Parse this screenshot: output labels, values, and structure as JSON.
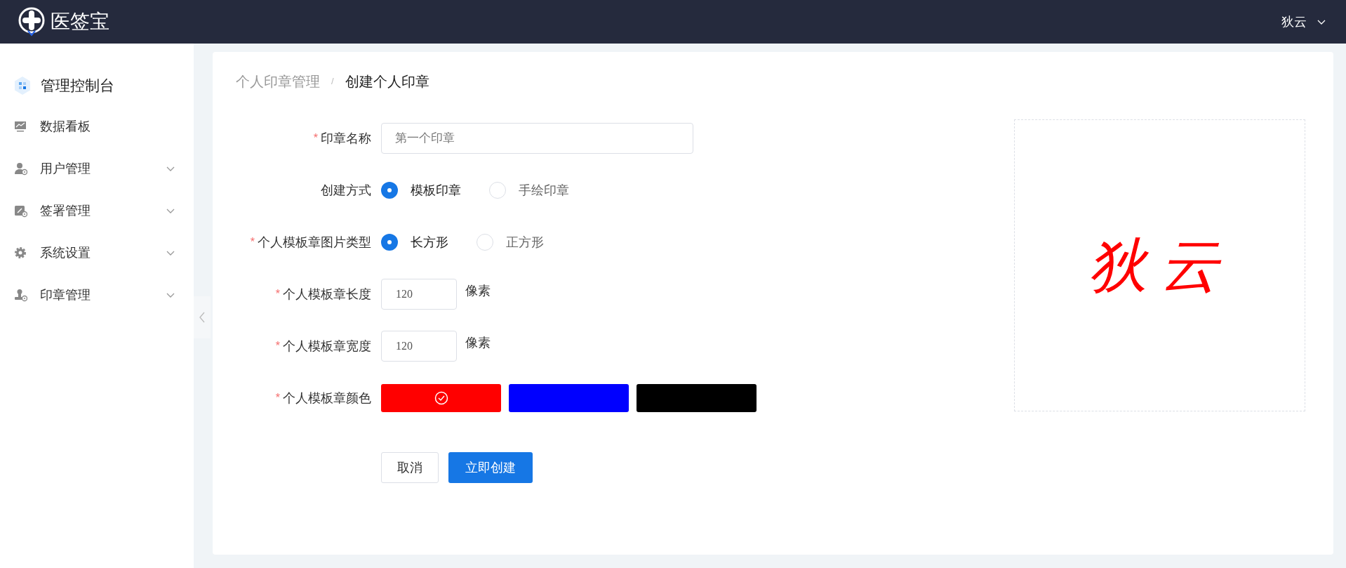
{
  "header": {
    "logo_text": "医签宝",
    "user": "狄云"
  },
  "sidebar": {
    "title": "管理控制台",
    "items": [
      {
        "label": "数据看板",
        "expandable": false
      },
      {
        "label": "用户管理",
        "expandable": true
      },
      {
        "label": "签署管理",
        "expandable": true
      },
      {
        "label": "系统设置",
        "expandable": true
      },
      {
        "label": "印章管理",
        "expandable": true
      }
    ]
  },
  "breadcrumb": {
    "separator": "/",
    "items": [
      {
        "label": "个人印章管理",
        "current": false
      },
      {
        "label": "创建个人印章",
        "current": true
      }
    ]
  },
  "form": [
    {
      "kind": "text",
      "label": "印章名称",
      "required_mark": "*",
      "placeholder": "第一个印章"
    },
    {
      "kind": "radio",
      "label": "创建方式",
      "options": [
        {
          "label": "模板印章",
          "selected": true
        },
        {
          "label": "手绘印章",
          "selected": false
        }
      ]
    },
    {
      "kind": "radio",
      "label": "个人模板章图片类型",
      "required_mark": "*",
      "options": [
        {
          "label": "长方形",
          "selected": true
        },
        {
          "label": "正方形",
          "selected": false
        }
      ]
    },
    {
      "kind": "number",
      "label": "个人模板章长度",
      "required_mark": "*",
      "value": "120",
      "unit": "像素"
    },
    {
      "kind": "number",
      "label": "个人模板章宽度",
      "required_mark": "*",
      "value": "120",
      "unit": "像素"
    },
    {
      "kind": "color",
      "label": "个人模板章颜色",
      "required_mark": "*",
      "swatches": [
        {
          "color": "#ff0000",
          "selected": true
        },
        {
          "color": "#0000ff",
          "selected": false
        },
        {
          "color": "#000000",
          "selected": false
        }
      ]
    }
  ],
  "buttons": [
    {
      "label": "取消",
      "kind": "secondary"
    },
    {
      "label": "立即创建",
      "kind": "primary"
    }
  ],
  "preview": {
    "text": "狄云",
    "color": "#ff0000"
  }
}
